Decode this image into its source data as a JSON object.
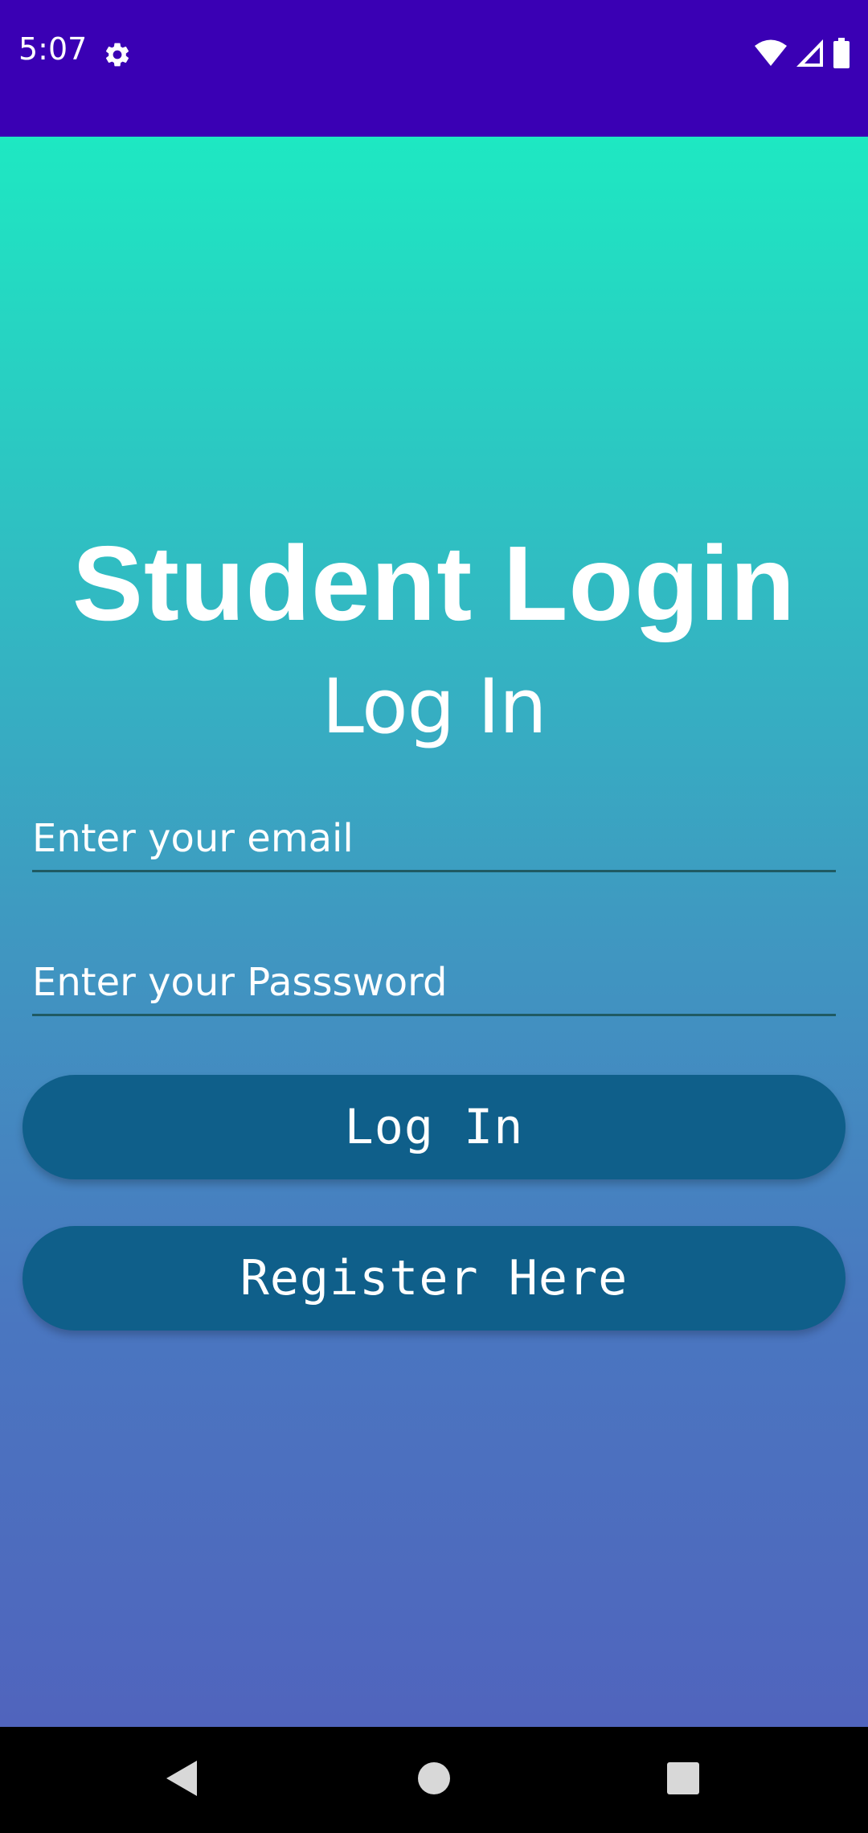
{
  "status_bar": {
    "time": "5:07",
    "icons": [
      "gear-icon",
      "wifi-icon",
      "cellular-signal-icon",
      "battery-icon"
    ],
    "background_color": "#3a00b4"
  },
  "login": {
    "title": "Student Login",
    "subtitle": "Log In",
    "email_placeholder": "Enter your email",
    "password_placeholder": "Enter your Passsword",
    "login_button": "Log In",
    "register_button": "Register Here"
  },
  "colors": {
    "gradient_top": "#1ee8c2",
    "gradient_bottom": "#5064bd",
    "button": "#0f5f8a"
  },
  "nav_bar": {
    "icons": [
      "back-icon",
      "home-icon",
      "recents-icon"
    ]
  }
}
